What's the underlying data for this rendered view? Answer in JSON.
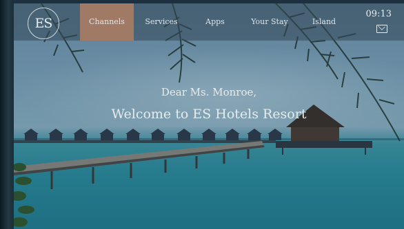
{
  "nav": {
    "items": [
      {
        "label": "Channels",
        "active": true
      },
      {
        "label": "Services",
        "active": false
      },
      {
        "label": "Apps",
        "active": false
      },
      {
        "label": "Your Stay",
        "active": false
      },
      {
        "label": "Island",
        "active": false
      }
    ]
  },
  "logo": {
    "text": "ES"
  },
  "status": {
    "time": "09:13"
  },
  "welcome": {
    "greeting": "Dear Ms. Monroe,",
    "headline": "Welcome to ES Hotels Resort"
  },
  "colors": {
    "active_tab": "#a07a64",
    "sea": "#2a8e9c"
  },
  "icons": {
    "mail": "mail-icon"
  }
}
